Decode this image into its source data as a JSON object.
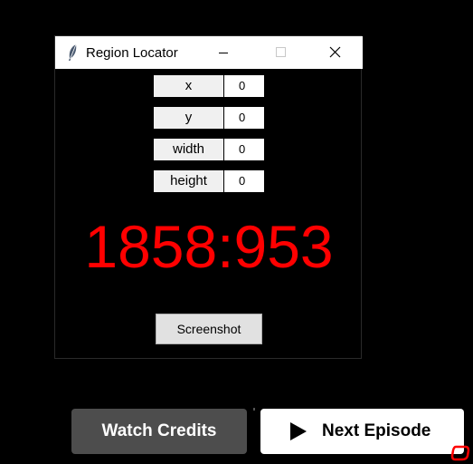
{
  "window": {
    "title": "Region Locator",
    "icons": {
      "app": "feather-icon",
      "minimize": "minimize-icon",
      "maximize": "maximize-icon",
      "close": "close-icon"
    }
  },
  "fields": [
    {
      "label": "x",
      "value": "0"
    },
    {
      "label": "y",
      "value": "0"
    },
    {
      "label": "width",
      "value": "0"
    },
    {
      "label": "height",
      "value": "0"
    }
  ],
  "coordinate_readout": "1858:953",
  "screenshot_button": "Screenshot",
  "overlay": {
    "watch_credits": "Watch Credits",
    "next_episode": "Next Episode",
    "next_icon": "play-icon"
  },
  "colors": {
    "readout": "#ff0000",
    "background": "#000000",
    "watch_button": "#4d4d4d",
    "next_button": "#ffffff",
    "cursor_marker": "#ff0000"
  }
}
